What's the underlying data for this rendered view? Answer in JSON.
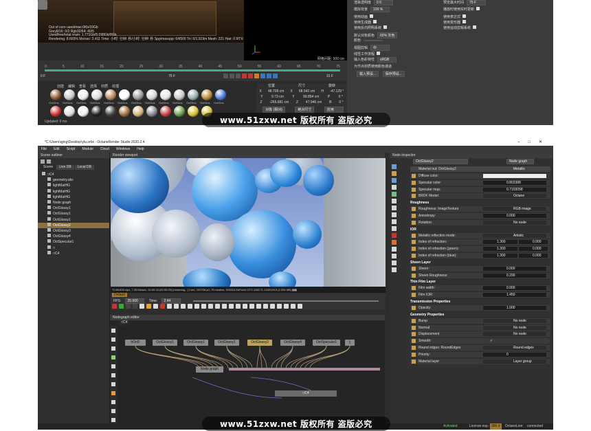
{
  "top": {
    "render_stats": [
      "Out of core used/max:0Kb/10Gb",
      "Grey8/16: 0/3        Rgb32/64: 40/5",
      "Used/free/total vram: 1.771Gb/5.098Gb/8Gb",
      "Rendering: 8.665%  Ms/sec: 2.411   Time: 小时: 分钟: 秒/小时: 分钟: 秒   Spp/maxspp: 64/500   Tri: 0/1.919m  Mesh: 221  Hair: 0   RTX:off   GPU: 55"
    ],
    "props": [
      {
        "label": "渲染透明度",
        "value": "0 0"
      },
      {
        "label": "模拟背景",
        "value": "100 %"
      },
      {
        "label": "使用动画",
        "check": true
      },
      {
        "label": "使用生成器",
        "check": true
      },
      {
        "label": "使用反向照明系统",
        "check": true
      },
      {
        "label": "默认对象颜色",
        "value": "60% 灰色"
      },
      {
        "label": "颜色",
        "value": ""
      },
      {
        "label": "视图剪辑",
        "value": "中"
      },
      {
        "label": "线性工作流程",
        "check": true
      },
      {
        "label": "输入色彩特性",
        "value": "sRGB"
      },
      {
        "label": "为节点材质使用颜色通道",
        "check": false
      }
    ],
    "props_right": [
      {
        "label": "预览最大时间",
        "value": "75 F"
      },
      {
        "label": "播放时使用实时更新",
        "check": true
      },
      {
        "label": "使用表达式",
        "check": true
      },
      {
        "label": "使用变形器",
        "check": true
      },
      {
        "label": "使用运动剪辑系统",
        "check": true
      }
    ],
    "buttons": [
      "载入预设...",
      "保存预设..."
    ],
    "ruler": [
      "0",
      "5",
      "10",
      "15",
      "20",
      "25",
      "30",
      "35",
      "40",
      "45",
      "50",
      "55",
      "60",
      "65",
      "70",
      "75"
    ],
    "frame_start": "0 F",
    "frame_cur": "75 F",
    "frame_end": "31 F",
    "mat_menu": [
      "创建",
      "编辑",
      "查看",
      "选择",
      "材质",
      "纹理"
    ],
    "mat_labels": [
      "OctGlos",
      "OctGlos",
      "OctGlos",
      "OctGlos",
      "OctGlos",
      "OctGlos",
      "OctGlos",
      "OctGlos",
      "OctGlos",
      "OctGlos",
      "OctGlos",
      "OctGlos",
      "OctGlos",
      "OctGlos",
      "OctGlos"
    ],
    "coord_headers": [
      "位置",
      "尺寸",
      "旋转"
    ],
    "coords": [
      [
        "X",
        "48.709 cm",
        "X",
        "68.542 cm",
        "H",
        "-47.129 °"
      ],
      [
        "Y",
        "9.73 cm",
        "Y",
        "99.854 cm",
        "P",
        "0 °"
      ],
      [
        "Z",
        "-265.681 cm",
        "Z",
        "47.946 cm",
        "B",
        "0 °"
      ]
    ],
    "coord_btns": [
      "对象 (相对)",
      "绝对尺寸",
      "应用"
    ],
    "footer": "Updated: 0 ms",
    "grid_readout": "网格间距: 500 cm"
  },
  "watermark": "www.51zxw.net 版权所有 盗版必究",
  "app": {
    "title": "*C:\\Users\\qjing\\Desktop\\ylu.orbx - OctaneRender Studio 2020.2.4",
    "menus": [
      "File",
      "Edit",
      "Script",
      "Module",
      "Cloud",
      "Windows",
      "Help"
    ],
    "outliner_title": "Scene outliner",
    "outliner_tabs": [
      "Scene",
      "Live DB",
      "Local DB"
    ],
    "tree": [
      {
        "label": "□C4",
        "root": true
      },
      {
        "label": "geometry.abc"
      },
      {
        "label": "lightMatHG"
      },
      {
        "label": "lightMatHG"
      },
      {
        "label": "lightMatHG"
      },
      {
        "label": "Node graph"
      },
      {
        "label": "OctGlossy1"
      },
      {
        "label": "OctGlossy1"
      },
      {
        "label": "OctGlossy1"
      },
      {
        "label": "OctGlossy2",
        "sel": true
      },
      {
        "label": "OctGlossy3"
      },
      {
        "label": "OctGlossy4"
      },
      {
        "label": "OctSpecular1"
      },
      {
        "label": "□"
      },
      {
        "label": "□C4"
      }
    ],
    "viewport_title": "Render viewport",
    "viewport_status": "72.80/400 s/px, 7.25 Ms/sec, 00:00:18 (00:00:29) [rendering...]     1 tex, 100796 pri, 79 meshes, NVIDIA GeForce GTX 1080 Ti, 1432/1913 (1.094 MB) ▮▮▮",
    "transport_label": "Default",
    "fps_label": "FPS:",
    "fps_value": "25.000",
    "time_label": "Time:",
    "time_value": "2.44",
    "nodegraph_title": "Nodegraph editor",
    "nodegraph_tab": "□C4",
    "nodes": [
      {
        "label": "hOnD"
      },
      {
        "label": "OctGlossy1"
      },
      {
        "label": "OctGlossy1"
      },
      {
        "label": "OctGlossy1"
      },
      {
        "label": "OctGlossy2",
        "sel": true
      },
      {
        "label": "OctGlossy4"
      },
      {
        "label": "OctSpecular1"
      },
      {
        "label": "▯"
      }
    ],
    "node_graph_node": "Node graph",
    "output_node": "□C4",
    "inspector_title": "Node inspector",
    "inspector_target": "OctGlossy2",
    "inspector_mode": "Node graph",
    "material_row": {
      "label": "Material out: OctGlossy2",
      "value": "Metallic"
    },
    "inspector_rows": [
      {
        "label": "Diffuse color:",
        "type": "bar"
      },
      {
        "label": "Specular color:",
        "type": "num",
        "value": "0.802388"
      },
      {
        "label": "Specular map:",
        "type": "num",
        "value": "0.7103058"
      },
      {
        "label": "BRDF Model:",
        "type": "dd",
        "value": "Octane"
      },
      {
        "section": "Roughness"
      },
      {
        "label": "Roughness: ImageTexture",
        "type": "dd",
        "value": "RGB image"
      },
      {
        "label": "Anisotropy:",
        "type": "num",
        "value": "0.000"
      },
      {
        "label": "Rotation:",
        "type": "dd",
        "value": "No node"
      },
      {
        "section": "IOR"
      },
      {
        "label": "Metallic reflection mode:",
        "type": "dd",
        "value": "Artistic"
      },
      {
        "label": "Index of refraction:",
        "type": "pair",
        "value": "1.300",
        "value2": "0.000"
      },
      {
        "label": "Index of refraction (green):",
        "type": "pair",
        "value": "1.300",
        "value2": "0.000"
      },
      {
        "label": "Index of refraction (blue):",
        "type": "pair",
        "value": "1.300",
        "value2": "0.000"
      },
      {
        "section": "Sheen Layer"
      },
      {
        "label": "Sheen:",
        "type": "num",
        "value": "0.000"
      },
      {
        "label": "Sheen Roughness:",
        "type": "num",
        "value": "0.200"
      },
      {
        "section": "Thin Film Layer"
      },
      {
        "label": "Film width:",
        "type": "num",
        "value": "0.000"
      },
      {
        "label": "Film IOR:",
        "type": "num",
        "value": "1.450"
      },
      {
        "section": "Transmission Properties"
      },
      {
        "label": "Opacity:",
        "type": "num",
        "value": "1.000"
      },
      {
        "section": "Geometry Properties"
      },
      {
        "label": "Bump",
        "type": "dd",
        "value": "No node"
      },
      {
        "label": "Normal",
        "type": "dd",
        "value": "No node"
      },
      {
        "label": "Displacement",
        "type": "dd",
        "value": "No node"
      },
      {
        "label": "Smooth:",
        "type": "check"
      },
      {
        "label": "Round edges: RoundEdges",
        "type": "dd",
        "value": "Round edges"
      },
      {
        "label": "Priority:",
        "type": "num",
        "value": "0"
      },
      {
        "label": "Material layer",
        "type": "dd",
        "value": "Layer group"
      }
    ],
    "status": {
      "activated": "Activated",
      "license": "License exp.:",
      "license_val": "365 d",
      "live": "OctaneLive:",
      "live_val": "connected"
    }
  }
}
